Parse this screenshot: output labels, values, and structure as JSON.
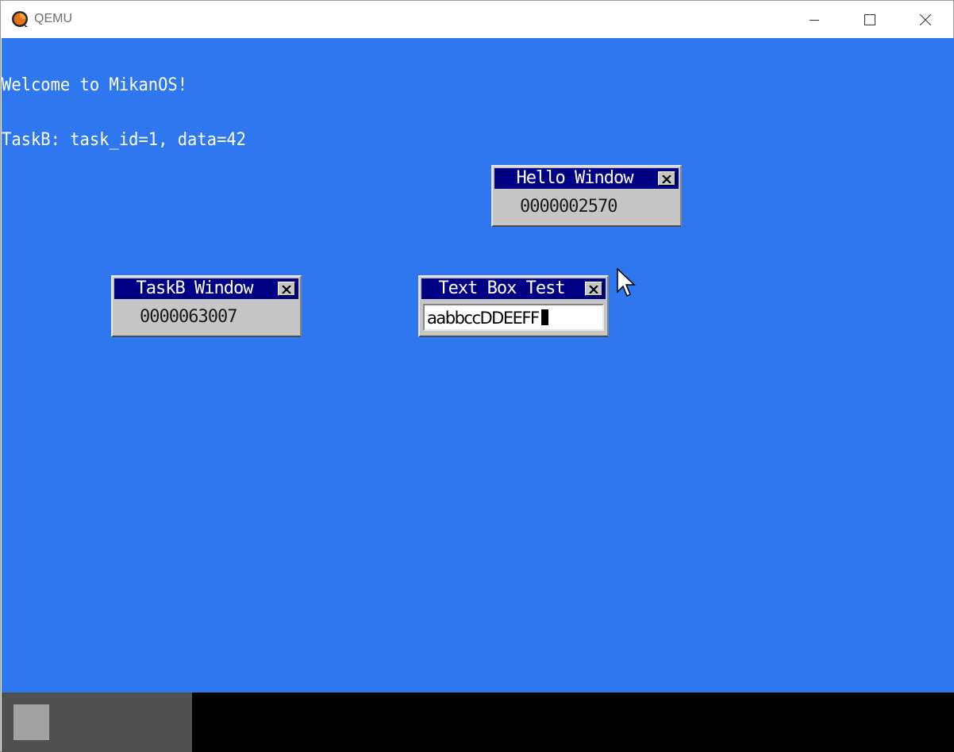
{
  "host": {
    "title": "QEMU",
    "icon": "qemu-logo-icon",
    "controls": [
      "minimize-icon",
      "maximize-icon",
      "close-icon"
    ]
  },
  "screen": {
    "background": "#2e77ee",
    "console_lines": [
      "Welcome to MikanOS!",
      "TaskB: task_id=1, data=42"
    ]
  },
  "windows": {
    "hello": {
      "title": "Hello Window",
      "counter": "0000002570"
    },
    "taskb": {
      "title": "TaskB Window",
      "counter": "0000063007"
    },
    "textbox": {
      "title": "Text Box Test",
      "value": "aabbccDDEEFF"
    }
  },
  "colors": {
    "window_title_bar": "#000084",
    "window_body": "#c6c6c6",
    "taskbar": "#000000",
    "taskbar_left": "#505050",
    "start_button": "#a2a2a2"
  }
}
